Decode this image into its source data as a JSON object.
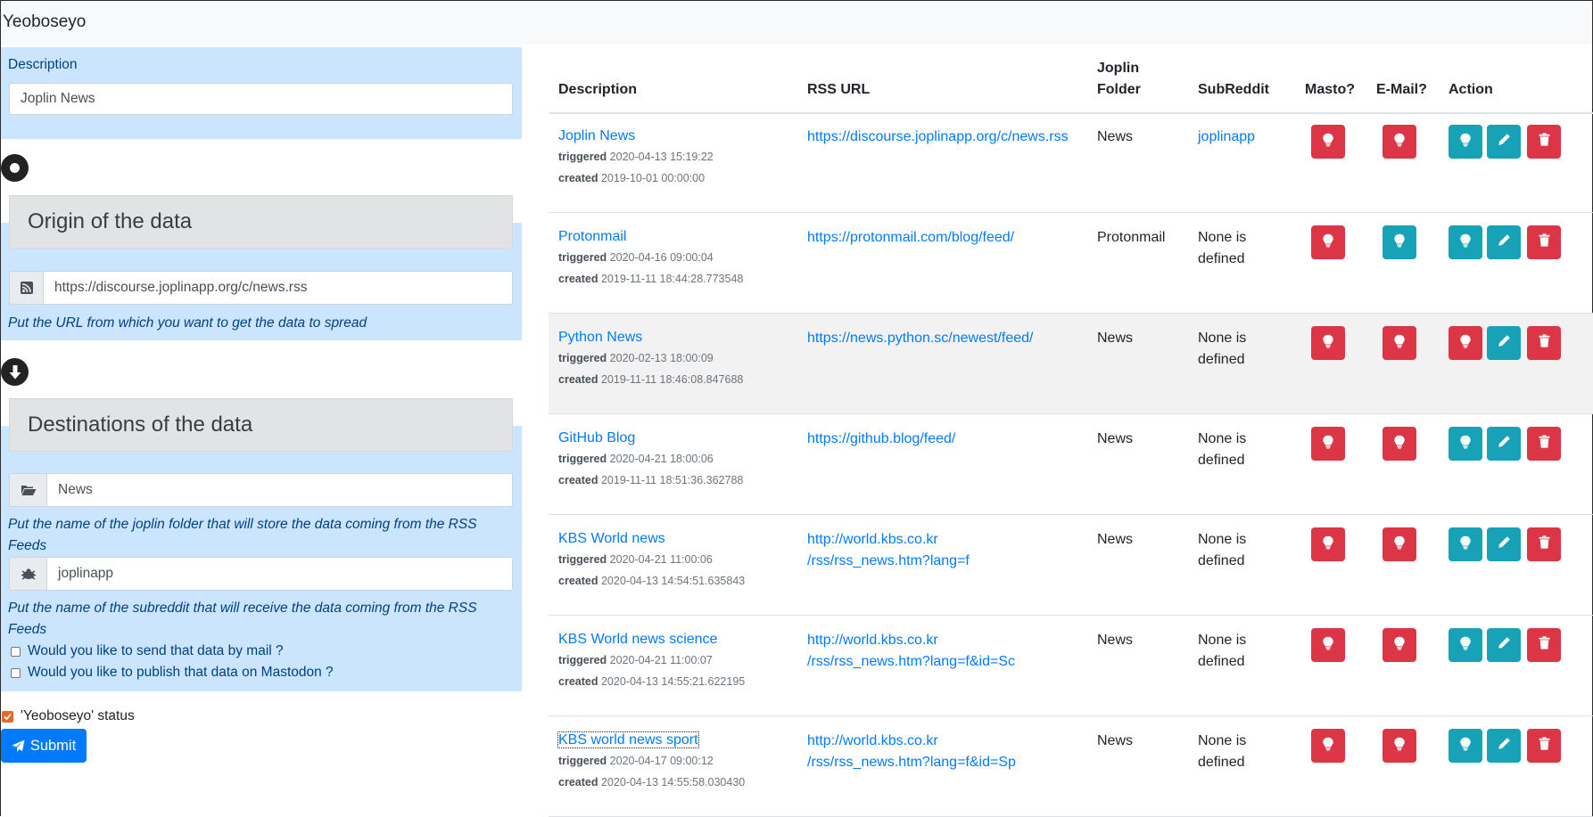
{
  "app": {
    "title": "Yeoboseyo"
  },
  "form": {
    "description_label": "Description",
    "description_value": "Joplin News",
    "origin_title": "Origin of the data",
    "rss_url_value": "https://discourse.joplinapp.org/c/news.rss",
    "rss_url_help": "Put the URL from which you want to get the data to spread",
    "destinations_title": "Destinations of the data",
    "joplin_folder_value": "News",
    "joplin_folder_help": "Put the name of the joplin folder that will store the data coming from the RSS Feeds",
    "subreddit_value": "joplinapp",
    "subreddit_help": "Put the name of the subreddit that will receive the data coming from the RSS Feeds",
    "mail_label": "Would you like to send that data by mail ?",
    "mastodon_label": "Would you like to publish that data on Mastodon ?",
    "status_label": "'Yeoboseyo' status",
    "submit_label": "Submit"
  },
  "table": {
    "headers": {
      "description": "Description",
      "rss_url": "RSS URL",
      "joplin_folder_1": "Joplin",
      "joplin_folder_2": "Folder",
      "subreddit": "SubReddit",
      "masto": "Masto?",
      "email": "E-Mail?",
      "action": "Action"
    },
    "triggered_label": "triggered",
    "created_label": "created",
    "rows": [
      {
        "name": "Joplin News",
        "triggered": "2020-04-13 15:19:22",
        "created": "2019-10-01 00:00:00",
        "rss_1": "https://discourse.joplinapp.org/c/news.rss",
        "rss_2": "",
        "folder": "News",
        "sub_1": "joplinapp",
        "sub_2": ""
      },
      {
        "name": "Protonmail",
        "triggered": "2020-04-16 09:00:04",
        "created": "2019-11-11 18:44:28.773548",
        "rss_1": "https://protonmail.com/blog/feed/",
        "rss_2": "",
        "folder": "Protonmail",
        "sub_1": "None is",
        "sub_2": "defined"
      },
      {
        "name": "Python News",
        "triggered": "2020-02-13 18:00:09",
        "created": "2019-11-11 18:46:08.847688",
        "rss_1": "https://news.python.sc/newest/feed/",
        "rss_2": "",
        "folder": "News",
        "sub_1": "None is",
        "sub_2": "defined"
      },
      {
        "name": "GitHub Blog",
        "triggered": "2020-04-21 18:00:06",
        "created": "2019-11-11 18:51:36.362788",
        "rss_1": "https://github.blog/feed/",
        "rss_2": "",
        "folder": "News",
        "sub_1": "None is",
        "sub_2": "defined"
      },
      {
        "name": "KBS World news",
        "triggered": "2020-04-21 11:00:06",
        "created": "2020-04-13 14:54:51.635843",
        "rss_1": "http://world.kbs.co.kr",
        "rss_2": "/rss/rss_news.htm?lang=f",
        "folder": "News",
        "sub_1": "None is",
        "sub_2": "defined"
      },
      {
        "name": "KBS World news science",
        "triggered": "2020-04-21 11:00:07",
        "created": "2020-04-13 14:55:21.622195",
        "rss_1": "http://world.kbs.co.kr",
        "rss_2": "/rss/rss_news.htm?lang=f&id=Sc",
        "folder": "News",
        "sub_1": "None is",
        "sub_2": "defined"
      },
      {
        "name": "KBS world news sport",
        "triggered": "2020-04-17 09:00:12",
        "created": "2020-04-13 14:55:58.030430",
        "rss_1": "http://world.kbs.co.kr",
        "rss_2": "/rss/rss_news.htm?lang=f&id=Sp",
        "folder": "News",
        "sub_1": "None is",
        "sub_2": "defined"
      }
    ]
  },
  "colors": {
    "danger": "#dc3545",
    "info": "#17a2b8",
    "primary": "#007bff",
    "panel_bg": "#cce5ff"
  },
  "icons": {
    "rss_addon": "rss-icon",
    "folder_addon": "folder-open-icon",
    "subreddit_addon": "reddit-alien-icon",
    "origin_marker": "dot-circle-icon",
    "destination_marker": "arrow-circle-down-icon",
    "masto_toggle": "lightbulb-icon",
    "email_toggle": "lightbulb-icon",
    "status_toggle": "lightbulb-icon",
    "edit": "pencil-icon",
    "delete": "trash-icon",
    "submit": "paper-plane-icon"
  }
}
